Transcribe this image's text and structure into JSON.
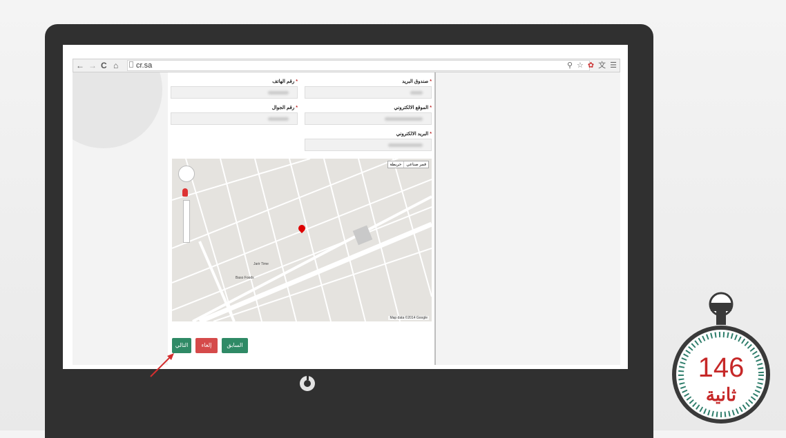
{
  "browser": {
    "url": "cr.sa",
    "back_icon": "arrow-left-icon",
    "forward_icon": "arrow-right-icon",
    "reload_icon": "reload-icon",
    "home_icon": "home-icon"
  },
  "form": {
    "fields": [
      {
        "label": "صندوق البريد"
      },
      {
        "label": "رقم الهاتف"
      },
      {
        "label": "الموقع الالكتروني"
      },
      {
        "label": "رقم الجوال"
      },
      {
        "label": "البريد الالكتروني"
      }
    ],
    "map": {
      "type_map": "خريطة",
      "type_satellite": "قمر صناعي",
      "label_1": "Jarir Time",
      "label_2": "Baso Foods",
      "footer": "Map data ©2014 Google"
    },
    "buttons": {
      "next": "التالي",
      "cancel": "إلغاء",
      "previous": "السابق"
    }
  },
  "timer": {
    "seconds": "146",
    "word": "ثانية"
  },
  "colors": {
    "accent_green": "#2f8a66",
    "cancel_red": "#d54a4a",
    "timer_red": "#c62828",
    "timer_green": "#2e7d6b"
  }
}
